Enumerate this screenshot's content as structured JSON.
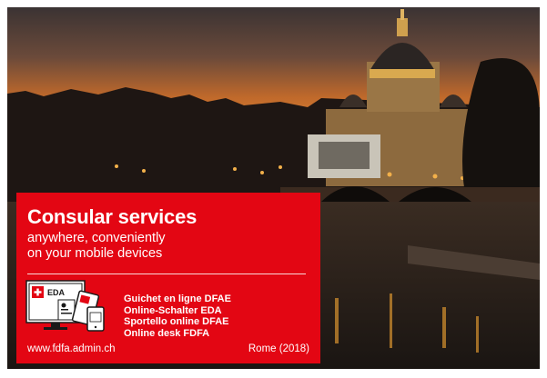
{
  "panel": {
    "title": "Consular services",
    "subtitle_line1": "anywhere, conveniently",
    "subtitle_line2": "on your mobile devices",
    "icon_label": "EDA",
    "desk_names": [
      "Guichet en ligne DFAE",
      "Online-Schalter EDA",
      "Sportello online DFAE",
      "Online desk FDFA"
    ],
    "website": "www.fdfa.admin.ch",
    "photo_caption": "Rome (2018)"
  },
  "colors": {
    "panel_red": "#e30613",
    "text": "#ffffff"
  }
}
